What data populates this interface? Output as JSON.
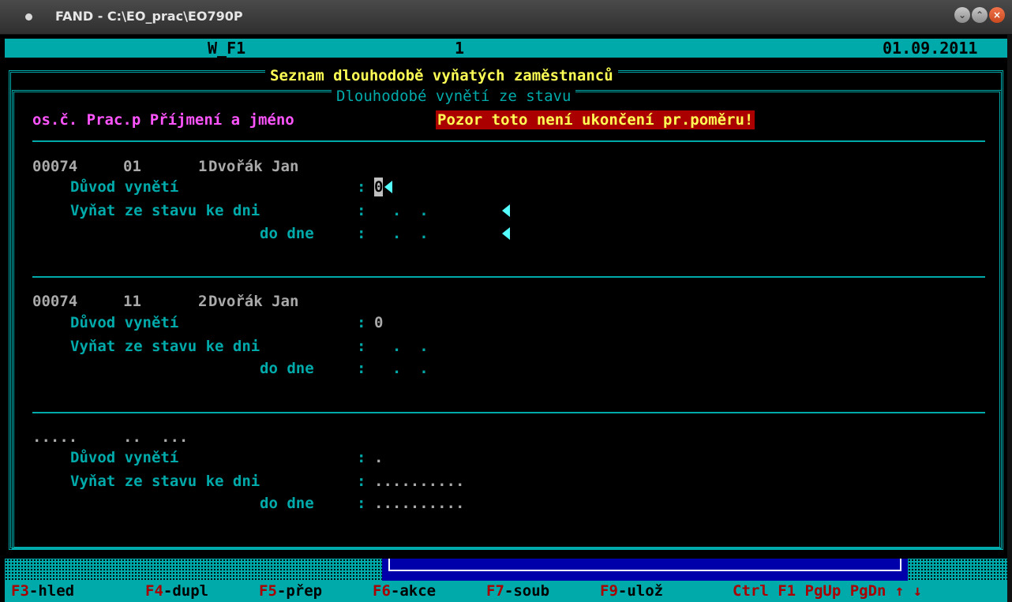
{
  "window": {
    "title": "FAND - C:\\EO_prac\\EO790P"
  },
  "status": {
    "form": "W_F1",
    "page": "1",
    "date": "01.09.2011"
  },
  "header": {
    "title": "Seznam dlouhodobě vyňatých zaměstnanců",
    "subtitle": "Dlouhodobé vynětí ze stavu"
  },
  "columns": {
    "label": "os.č. Prac.p Příjmení a jméno",
    "warning": "Pozor toto není ukončení pr.poměru!"
  },
  "labels": {
    "reason": "Důvod vynětí",
    "from": "Vyňat ze stavu ke dni",
    "to": "do dne"
  },
  "records": [
    {
      "id": "00074",
      "prac": "01",
      "num": "1",
      "name": "Dvořák Jan",
      "reason": "0",
      "from": "  .  .",
      "to": "  .  ."
    },
    {
      "id": "00074",
      "prac": "11",
      "num": "2",
      "name": "Dvořák Jan",
      "reason": "0",
      "from": "  .  .",
      "to": "  .  ."
    },
    {
      "id": ".....",
      "prac": "..",
      "num": "...",
      "name": "",
      "reason": ".",
      "from": "..........",
      "to": ".........."
    }
  ],
  "fkeys": [
    {
      "key": "F3",
      "label": "-hled"
    },
    {
      "key": "F4",
      "label": "-dupl"
    },
    {
      "key": "F5",
      "label": "-přep"
    },
    {
      "key": "F6",
      "label": "-akce"
    },
    {
      "key": "F7",
      "label": "-soub"
    },
    {
      "key": "F9",
      "label": "-ulož"
    },
    {
      "key": "Ctrl F1 PgUp PgDn ↑ ↓",
      "label": ""
    }
  ]
}
